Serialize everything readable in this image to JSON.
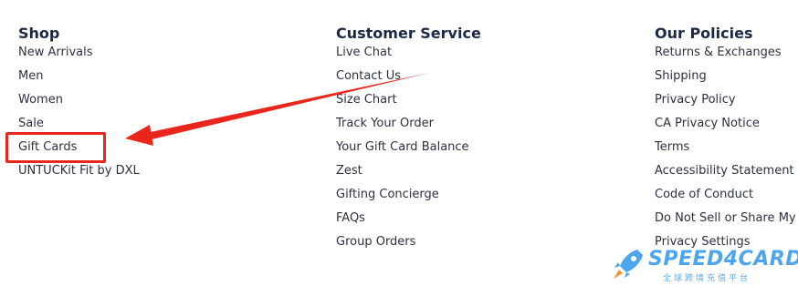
{
  "footer": {
    "columns": [
      {
        "title": "Shop",
        "links": [
          "New Arrivals",
          "Men",
          "Women",
          "Sale",
          "Gift Cards",
          "UNTUCKit Fit by DXL"
        ]
      },
      {
        "title": "Customer Service",
        "links": [
          "Live Chat",
          "Contact Us",
          "Size Chart",
          "Track Your Order",
          "Your Gift Card Balance",
          "Zest",
          "Gifting Concierge",
          "FAQs",
          "Group Orders"
        ]
      },
      {
        "title": "Our Policies",
        "links": [
          "Returns & Exchanges",
          "Shipping",
          "Privacy Policy",
          "CA Privacy Notice",
          "Terms",
          "Accessibility Statement",
          "Code of Conduct",
          "Do Not Sell or Share My",
          "Privacy Settings"
        ]
      }
    ]
  },
  "annotation": {
    "highlight_color": "#e8261c"
  },
  "watermark": {
    "brand": "SPEED4CARD",
    "tagline": "全球跨境充值平台",
    "color": "#2f97ea",
    "icon": "rocket-icon"
  }
}
